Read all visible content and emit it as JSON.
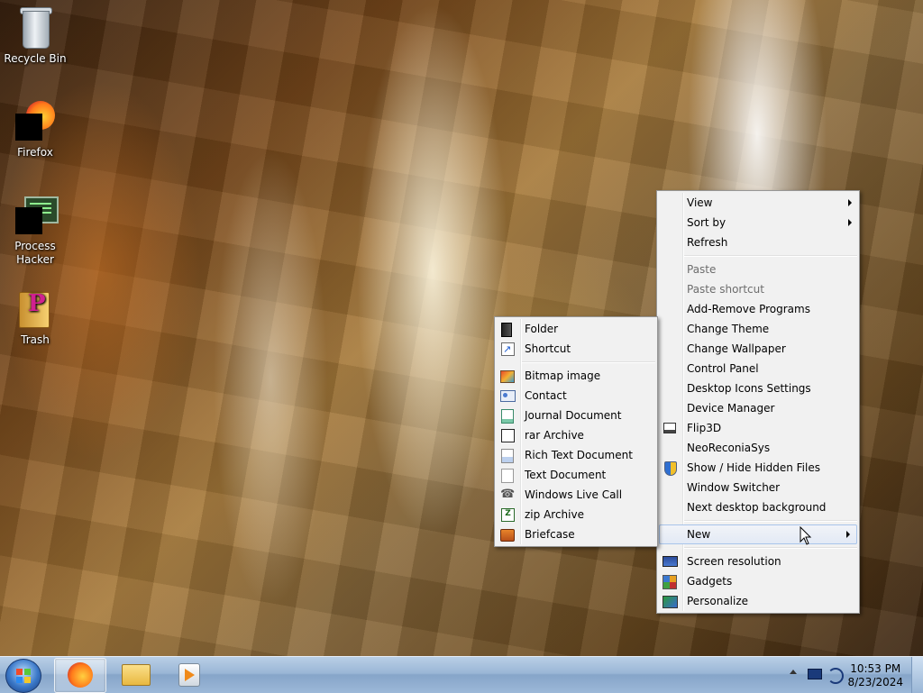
{
  "desktop": {
    "icons": [
      {
        "label": "Recycle Bin"
      },
      {
        "label": "Firefox"
      },
      {
        "label": "Process Hacker"
      },
      {
        "label": "Trash"
      }
    ]
  },
  "context_menu": {
    "view": "View",
    "sort_by": "Sort by",
    "refresh": "Refresh",
    "paste": "Paste",
    "paste_shortcut": "Paste shortcut",
    "add_remove_programs": "Add-Remove Programs",
    "change_theme": "Change Theme",
    "change_wallpaper": "Change Wallpaper",
    "control_panel": "Control Panel",
    "desktop_icons_settings": "Desktop Icons Settings",
    "device_manager": "Device Manager",
    "flip3d": "Flip3D",
    "neoreconiasys": "NeoReconiaSys",
    "show_hide_hidden_files": "Show / Hide Hidden Files",
    "window_switcher": "Window Switcher",
    "next_desktop_background": "Next desktop background",
    "new": "New",
    "screen_resolution": "Screen resolution",
    "gadgets": "Gadgets",
    "personalize": "Personalize"
  },
  "new_submenu": {
    "folder": "Folder",
    "shortcut": "Shortcut",
    "bitmap_image": "Bitmap image",
    "contact": "Contact",
    "journal_document": "Journal Document",
    "rar_archive": "rar Archive",
    "rich_text_document": "Rich Text Document",
    "text_document": "Text Document",
    "windows_live_call": "Windows Live Call",
    "zip_archive": "zip Archive",
    "briefcase": "Briefcase"
  },
  "taskbar": {
    "clock_time": "10:53 PM",
    "clock_date": "8/23/2024"
  }
}
